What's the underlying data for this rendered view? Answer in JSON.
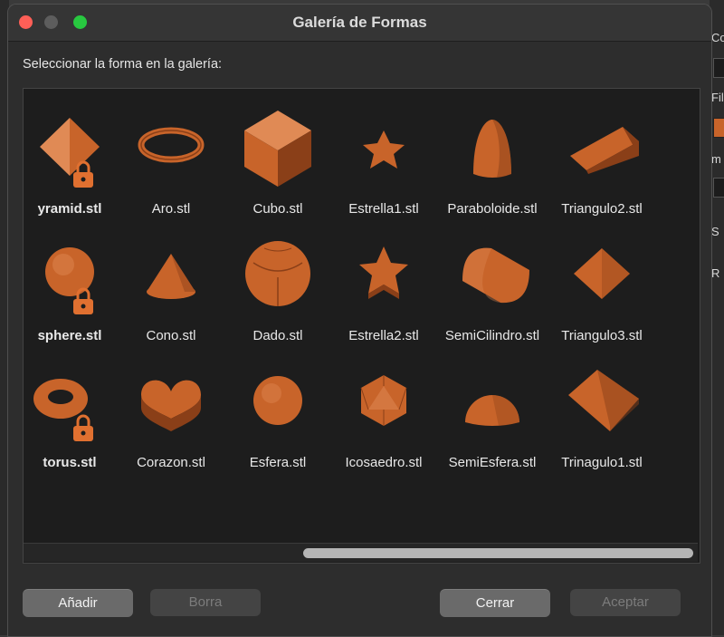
{
  "window": {
    "title": "Galería de Formas"
  },
  "prompt": "Seleccionar la forma en la galería:",
  "colors": {
    "shape": "#c8642a",
    "lock": "#e07030"
  },
  "gallery": {
    "items": [
      {
        "label": "yramid.stl",
        "shape": "pyramid",
        "locked": true,
        "bold": true
      },
      {
        "label": "Aro.stl",
        "shape": "ring",
        "locked": false,
        "bold": false
      },
      {
        "label": "Cubo.stl",
        "shape": "cube",
        "locked": false,
        "bold": false
      },
      {
        "label": "Estrella1.stl",
        "shape": "star-flat",
        "locked": false,
        "bold": false
      },
      {
        "label": "Paraboloide.stl",
        "shape": "paraboloid",
        "locked": false,
        "bold": false
      },
      {
        "label": "Triangulo2.stl",
        "shape": "wedge",
        "locked": false,
        "bold": false
      },
      {
        "label": "sphere.stl",
        "shape": "sphere",
        "locked": true,
        "bold": true
      },
      {
        "label": "Cono.stl",
        "shape": "cone",
        "locked": false,
        "bold": false
      },
      {
        "label": "Dado.stl",
        "shape": "dice",
        "locked": false,
        "bold": false
      },
      {
        "label": "Estrella2.stl",
        "shape": "star-thick",
        "locked": false,
        "bold": false
      },
      {
        "label": "SemiCilindro.stl",
        "shape": "half-cylinder",
        "locked": false,
        "bold": false
      },
      {
        "label": "Triangulo3.stl",
        "shape": "octahedron",
        "locked": false,
        "bold": false
      },
      {
        "label": "torus.stl",
        "shape": "torus",
        "locked": true,
        "bold": true
      },
      {
        "label": "Corazon.stl",
        "shape": "heart",
        "locked": false,
        "bold": false
      },
      {
        "label": "Esfera.stl",
        "shape": "sphere-small",
        "locked": false,
        "bold": false
      },
      {
        "label": "Icosaedro.stl",
        "shape": "icosahedron",
        "locked": false,
        "bold": false
      },
      {
        "label": "SemiEsfera.stl",
        "shape": "hemisphere",
        "locked": false,
        "bold": false
      },
      {
        "label": "Trinagulo1.stl",
        "shape": "prism",
        "locked": false,
        "bold": false
      }
    ]
  },
  "buttons": {
    "add": "Añadir",
    "delete": "Borra",
    "close": "Cerrar",
    "accept": "Aceptar"
  },
  "background_right": {
    "labels": [
      "Co",
      "Fil",
      "m",
      "S",
      "R"
    ]
  }
}
